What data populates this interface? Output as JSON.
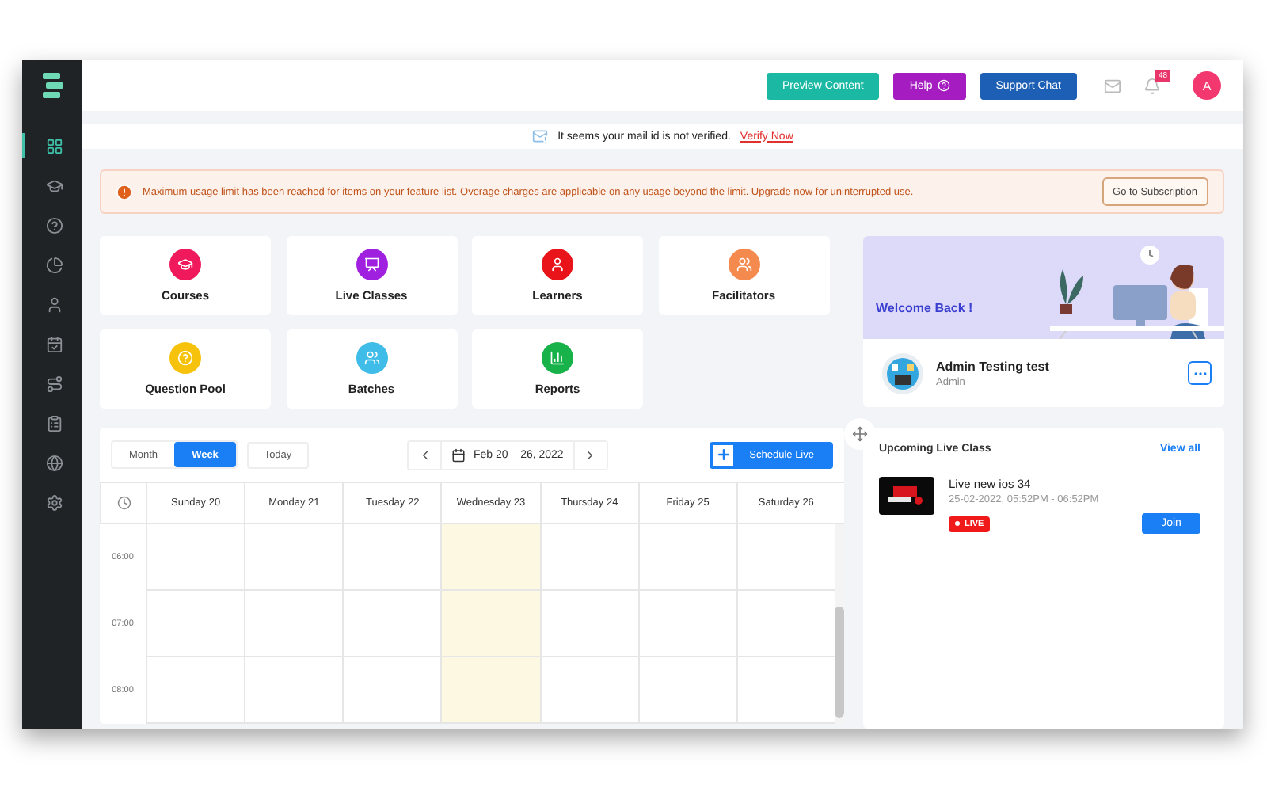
{
  "sidebar": {
    "items": [
      {
        "selected": true
      },
      {
        "selected": false
      },
      {
        "selected": false
      },
      {
        "selected": false
      },
      {
        "selected": false
      },
      {
        "selected": false
      },
      {
        "selected": false
      },
      {
        "selected": false
      },
      {
        "selected": false
      },
      {
        "selected": false
      }
    ]
  },
  "topbar": {
    "buttons": [
      {
        "label": "Preview Content",
        "color": "#1bb9a3"
      },
      {
        "label": "Help",
        "color": "#a51cc1"
      },
      {
        "label": "Support Chat",
        "color": "#1d5fb4"
      }
    ],
    "notification_count": "48",
    "avatar": "A"
  },
  "verify_bar": {
    "message": "It seems your mail id is not verified.",
    "link": "Verify Now"
  },
  "alert": {
    "message": "Maximum usage limit has been reached for items on your feature list. Overage charges are applicable on any usage beyond the limit. Upgrade now for uninterrupted use.",
    "button": "Go to Subscription"
  },
  "tiles": [
    {
      "label": "Courses",
      "color": "#f0195b"
    },
    {
      "label": "Live Classes",
      "color": "#a020e0"
    },
    {
      "label": "Learners",
      "color": "#e8141a"
    },
    {
      "label": "Facilitators",
      "color": "#f58a4e"
    },
    {
      "label": "Question Pool",
      "color": "#f7c20c"
    },
    {
      "label": "Batches",
      "color": "#3fbde8"
    },
    {
      "label": "Reports",
      "color": "#18b24b"
    }
  ],
  "calendar": {
    "views": [
      {
        "label": "Month",
        "selected": false
      },
      {
        "label": "Week",
        "selected": true
      }
    ],
    "today_button": "Today",
    "range": "Feb 20 – 26, 2022",
    "schedule_button": "Schedule Live",
    "days": [
      {
        "label": "Sunday 20",
        "highlighted": false
      },
      {
        "label": "Monday 21",
        "highlighted": false
      },
      {
        "label": "Tuesday 22",
        "highlighted": false
      },
      {
        "label": "Wednesday 23",
        "highlighted": true
      },
      {
        "label": "Thursday 24",
        "highlighted": false
      },
      {
        "label": "Friday 25",
        "highlighted": false
      },
      {
        "label": "Saturday 26",
        "highlighted": false
      }
    ],
    "times": [
      "06:00",
      "07:00",
      "08:00"
    ]
  },
  "welcome": {
    "title": "Welcome Back !",
    "name": "Admin Testing test",
    "role": "Admin"
  },
  "upcoming": {
    "title": "Upcoming Live Class",
    "link": "View all",
    "items": [
      {
        "name": "Live new ios 34",
        "time": "25-02-2022, 05:52PM - 06:52PM",
        "badge": "LIVE",
        "button": "Join"
      }
    ]
  }
}
